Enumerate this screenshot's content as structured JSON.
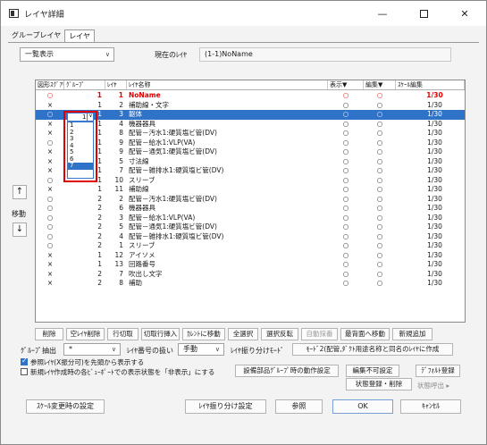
{
  "window": {
    "title": "レイヤ詳細",
    "minimize_glyph": "—",
    "close_glyph": "✕"
  },
  "tabs": [
    {
      "label": "グループレイヤ",
      "active": false
    },
    {
      "label": "レイヤ",
      "active": true
    }
  ],
  "view_combo": {
    "value": "一覧表示"
  },
  "current_layer": {
    "label": "現在のﾚｲﾔ",
    "value": "(1-1)NoName"
  },
  "grid": {
    "headers": [
      "図形ｽｸﾞｱﾘ",
      "ｸﾞﾙｰﾌﾟ",
      "ﾚｲﾔ",
      "ﾚｲﾔ名称",
      "表示▼",
      "編集▼",
      "ｽｹｰﾙ編集"
    ],
    "rows": [
      {
        "mark": "○",
        "group": "1",
        "layer": "1",
        "name": "NoName",
        "show": "○",
        "edit": "○",
        "scale": "1/30",
        "style": "red"
      },
      {
        "mark": "×",
        "group": "1",
        "layer": "2",
        "name": "補助線・文字",
        "show": "○",
        "edit": "○",
        "scale": "1/30",
        "style": ""
      },
      {
        "mark": "○",
        "group": "1",
        "layer": "3",
        "name": "躯体",
        "show": "○",
        "edit": "○",
        "scale": "1/30",
        "style": "selected"
      },
      {
        "mark": "×",
        "group": "1",
        "layer": "4",
        "name": "機器器具",
        "show": "○",
        "edit": "○",
        "scale": "1/30",
        "style": ""
      },
      {
        "mark": "×",
        "group": "1",
        "layer": "8",
        "name": "配管－汚水1:硬質塩ビ管(DV)",
        "show": "○",
        "edit": "○",
        "scale": "1/30",
        "style": ""
      },
      {
        "mark": "○",
        "group": "1",
        "layer": "9",
        "name": "配管－給水1:VLP(VA)",
        "show": "○",
        "edit": "○",
        "scale": "1/30",
        "style": ""
      },
      {
        "mark": "×",
        "group": "1",
        "layer": "9",
        "name": "配管－通気1:硬質塩ビ管(DV)",
        "show": "○",
        "edit": "○",
        "scale": "1/30",
        "style": ""
      },
      {
        "mark": "×",
        "group": "1",
        "layer": "5",
        "name": "寸法線",
        "show": "○",
        "edit": "○",
        "scale": "1/30",
        "style": ""
      },
      {
        "mark": "×",
        "group": "1",
        "layer": "7",
        "name": "配管－雑排水1:硬質塩ビ管(DV)",
        "show": "○",
        "edit": "○",
        "scale": "1/30",
        "style": ""
      },
      {
        "mark": "○",
        "group": "1",
        "layer": "10",
        "name": "スリーブ",
        "show": "○",
        "edit": "○",
        "scale": "1/30",
        "style": ""
      },
      {
        "mark": "×",
        "group": "1",
        "layer": "11",
        "name": "補助線",
        "show": "○",
        "edit": "○",
        "scale": "1/30",
        "style": ""
      },
      {
        "mark": "○",
        "group": "2",
        "layer": "2",
        "name": "配管－汚水1:硬質塩ビ管(DV)",
        "show": "○",
        "edit": "○",
        "scale": "1/30",
        "style": ""
      },
      {
        "mark": "○",
        "group": "2",
        "layer": "6",
        "name": "機器器具",
        "show": "○",
        "edit": "○",
        "scale": "1/30",
        "style": ""
      },
      {
        "mark": "○",
        "group": "2",
        "layer": "3",
        "name": "配管－給水1:VLP(VA)",
        "show": "○",
        "edit": "○",
        "scale": "1/30",
        "style": ""
      },
      {
        "mark": "○",
        "group": "2",
        "layer": "5",
        "name": "配管－通気1:硬質塩ビ管(DV)",
        "show": "○",
        "edit": "○",
        "scale": "1/30",
        "style": ""
      },
      {
        "mark": "○",
        "group": "2",
        "layer": "4",
        "name": "配管－雑排水1:硬質塩ビ管(DV)",
        "show": "○",
        "edit": "○",
        "scale": "1/30",
        "style": ""
      },
      {
        "mark": "○",
        "group": "2",
        "layer": "1",
        "name": "スリーブ",
        "show": "○",
        "edit": "○",
        "scale": "1/30",
        "style": ""
      },
      {
        "mark": "×",
        "group": "1",
        "layer": "12",
        "name": "アイソメ",
        "show": "○",
        "edit": "○",
        "scale": "1/30",
        "style": ""
      },
      {
        "mark": "×",
        "group": "1",
        "layer": "13",
        "name": "回路番号",
        "show": "○",
        "edit": "○",
        "scale": "1/30",
        "style": ""
      },
      {
        "mark": "×",
        "group": "2",
        "layer": "7",
        "name": "吹出し文字",
        "show": "○",
        "edit": "○",
        "scale": "1/30",
        "style": ""
      },
      {
        "mark": "×",
        "group": "2",
        "layer": "8",
        "name": "補助",
        "show": "○",
        "edit": "○",
        "scale": "1/30",
        "style": ""
      }
    ]
  },
  "group_dropdown": {
    "current": "1",
    "chevron": "∨",
    "options": [
      "1",
      "2",
      "3",
      "4",
      "5",
      "6",
      "7"
    ],
    "highlighted": "7"
  },
  "move": {
    "up": "↑",
    "label": "移動",
    "down": "↓"
  },
  "buttons_row1": [
    "削除",
    "空ﾚｲﾔ削除",
    "行切取",
    "切取行挿入",
    "ｶﾚﾝﾄに移動",
    "全選択",
    "選択反転",
    "自動採番",
    "最背面へ移動",
    "新規追加"
  ],
  "row2": {
    "group_extract_label": "ｸﾞﾙｰﾌﾟ抽出",
    "group_extract_value": "*",
    "numbering_label": "ﾚｲﾔ番号の扱い",
    "numbering_value": "手動",
    "split_mode_label": "ﾚｲﾔ振り分けﾓｰﾄﾞ",
    "split_mode_value": "ﾓｰﾄﾞ2(配管,ﾀﾞｸﾄ用途名称と同名のﾚｲﾔに作成"
  },
  "checkboxes": [
    {
      "label": "参照ﾚｲﾔ(X振分可)を先頭から表示する",
      "checked": true
    },
    {
      "label": "新規ﾚｲﾔ作成時の各ﾋﾞｭｰﾎﾟｰﾄでの表示状態を「非表示」にする",
      "checked": false
    }
  ],
  "side_buttons": {
    "parts_group": "設備部品ｸﾞﾙｰﾌﾟ時の動作設定",
    "edit_disable": "編集不可設定",
    "default_register": "ﾃﾞﾌｫﾙﾄ登録",
    "state_register": "状態登録・削除",
    "state_recall": "状態呼出 ▸"
  },
  "footer": {
    "scale_settings": "ｽｹｰﾙ変更時の設定",
    "split_settings": "ﾚｲﾔ振り分け設定",
    "reference": "参照",
    "ok": "OK",
    "cancel": "ｷｬﾝｾﾙ"
  }
}
